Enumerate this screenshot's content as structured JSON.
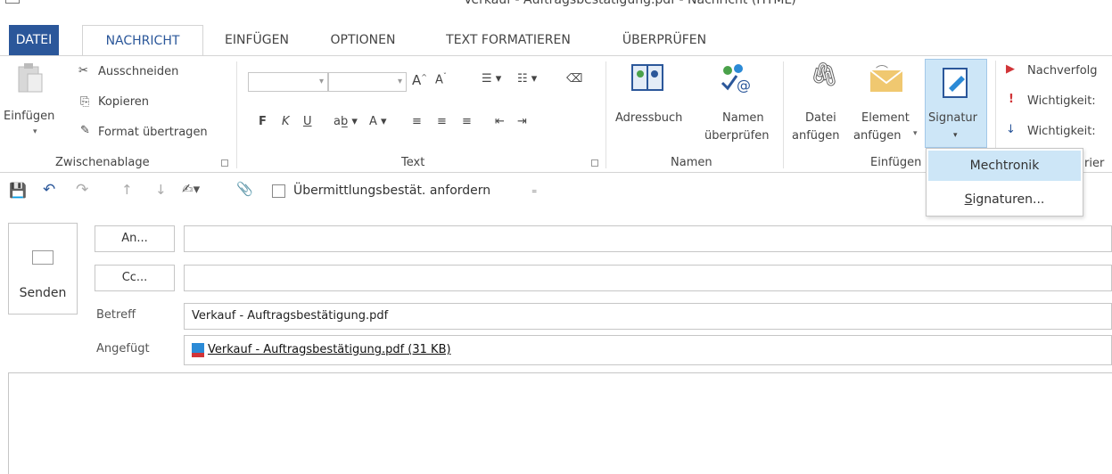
{
  "window": {
    "title": "Verkauf - Auftragsbestätigung.pdf - Nachricht (HTML)"
  },
  "tabs": [
    "DATEI",
    "NACHRICHT",
    "EINFÜGEN",
    "OPTIONEN",
    "TEXT FORMATIEREN",
    "ÜBERPRÜFEN"
  ],
  "ribbon": {
    "clipboard": {
      "paste": "Einfügen",
      "cut": "Ausschneiden",
      "copy": "Kopieren",
      "format_painter": "Format übertragen",
      "group": "Zwischenablage"
    },
    "text": {
      "bold": "F",
      "italic": "K",
      "underline": "U",
      "group": "Text"
    },
    "names": {
      "address_book": "Adressbuch",
      "check_names_1": "Namen",
      "check_names_2": "überprüfen",
      "group": "Namen"
    },
    "insert": {
      "attach_file_1": "Datei",
      "attach_file_2": "anfügen",
      "attach_item_1": "Element",
      "attach_item_2": "anfügen",
      "signature": "Signatur",
      "group": "Einfügen"
    },
    "tags": {
      "follow_up": "Nachverfolg",
      "high_importance": "Wichtigkeit:",
      "low_importance": "Wichtigkeit:",
      "group_partial": "rier"
    }
  },
  "qat": {
    "delivery_receipt": "Übermittlungsbestät. anfordern"
  },
  "signature_menu": {
    "items": [
      "Mechtronik",
      "Signaturen..."
    ]
  },
  "compose": {
    "send": "Senden",
    "to_button": "An...",
    "cc_button": "Cc...",
    "to_value": "",
    "cc_value": "",
    "subject_label": "Betreff",
    "subject_value": "Verkauf - Auftragsbestätigung.pdf",
    "attached_label": "Angefügt",
    "attachment": "Verkauf - Auftragsbestätigung.pdf (31 KB)"
  },
  "colors": {
    "accent": "#2b579a",
    "menu_highlight": "#cde6f7",
    "importance_red": "#d13438",
    "importance_blue": "#2b579a"
  }
}
